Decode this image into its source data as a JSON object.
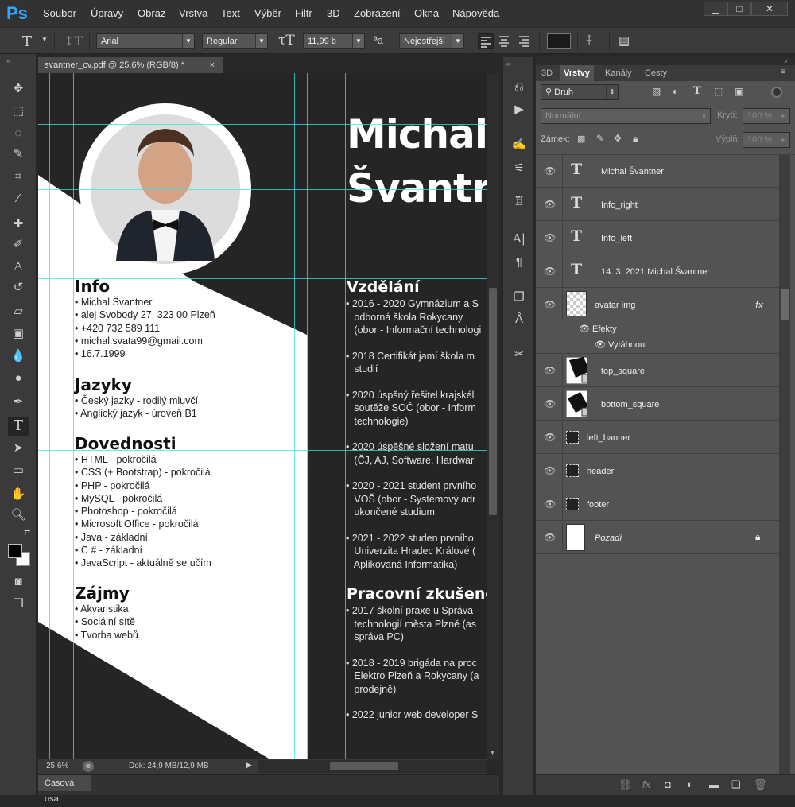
{
  "app": {
    "logo": "Ps"
  },
  "menu": [
    "Soubor",
    "Úpravy",
    "Obraz",
    "Vrstva",
    "Text",
    "Výběr",
    "Filtr",
    "3D",
    "Zobrazení",
    "Okna",
    "Nápověda"
  ],
  "window_controls": {
    "minimize": "▁",
    "maximize": "□",
    "close": "✕"
  },
  "options": {
    "font_family": "Arial",
    "font_style": "Regular",
    "font_size": "11,99 b",
    "antialias": "Nejostřejší",
    "color_hex": "#1a1a1a"
  },
  "document": {
    "tab_title": "svantner_cv.pdf @ 25,6% (RGB/8) *",
    "close": "×",
    "zoom": "25,6%",
    "doc_size": "Dok: 24,9 MB/12,9 MB"
  },
  "timeline_label": "Časová osa",
  "cv": {
    "name_line1": "Michal",
    "name_line2": "Švantr",
    "info": {
      "heading": "Info",
      "lines": [
        "• Michal Švantner",
        "• alej Svobody 27, 323 00 Plzeň",
        "• +420 732 589 111",
        "• michal.svata99@gmail.com",
        "• 16.7.1999"
      ]
    },
    "languages": {
      "heading": "Jazyky",
      "lines": [
        "• Český jazky - rodilý mluvčí",
        "• Anglický jazyk - úroveň B1"
      ]
    },
    "skills": {
      "heading": "Dovednosti",
      "lines": [
        "• HTML - pokročilá",
        "• CSS (+ Bootstrap) - pokročilá",
        "• PHP - pokročilá",
        "• MySQL - pokročilá",
        "• Photoshop - pokročilá",
        "• Microsoft Office - pokročilá",
        "• Java - základní",
        "• C # - základní",
        "• JavaScript - aktuálně se učím"
      ]
    },
    "hobbies": {
      "heading": "Zájmy",
      "lines": [
        "• Akvaristika",
        "• Sociální sítě",
        "• Tvorba webů"
      ]
    },
    "education": {
      "heading": "Vzdělání",
      "lines": [
        "• 2016 - 2020 Gymnázium a S",
        "   odborná škola Rokycany",
        "   (obor - Informační technologi",
        "",
        "• 2018 Certifikát jamí škola m",
        "   studií",
        "",
        "• 2020 úspšný řešitel krajskél",
        "   soutěže SOČ (obor - Inform",
        "   technologie)",
        "",
        "• 2020 úspěšné složení matu",
        "   (ČJ, AJ, Software, Hardwar",
        "",
        "• 2020 - 2021 student prvního",
        "   VOŠ (obor - Systémový adr",
        "   ukončené studium",
        "",
        "• 2021 - 2022 studen prvního",
        "   Univerzita Hradec Králové (",
        "   Aplikovaná Informatika)"
      ]
    },
    "experience": {
      "heading": "Pracovní zkušeno",
      "lines": [
        "• 2017 školní praxe u Správa",
        "   technologií města Plzně (as",
        "   správa PC)",
        "",
        "• 2018 - 2019 brigáda na proc",
        "   Elektro Plzeň a Rokycany (a",
        "   prodejně)",
        "",
        "• 2022 junior web developer S"
      ]
    }
  },
  "panel": {
    "tabs": [
      "3D",
      "Vrstvy",
      "Kanály",
      "Cesty"
    ],
    "filter_kind": "Druh",
    "blend_mode": "Normální",
    "opacity_label": "Krytí:",
    "opacity_value": "100 %",
    "lock_label": "Zámek:",
    "fill_label": "Výplň:",
    "fill_value": "100 %",
    "layers": [
      {
        "name": "Michal Švantner",
        "kind": "text"
      },
      {
        "name": "Info_right",
        "kind": "text"
      },
      {
        "name": "Info_left",
        "kind": "text"
      },
      {
        "name": "14. 3. 2021 Michal Švantner",
        "kind": "text"
      },
      {
        "name": "avatar img",
        "kind": "image",
        "fx": "fx"
      },
      {
        "name": "top_square",
        "kind": "shape"
      },
      {
        "name": "bottom_square",
        "kind": "shape"
      },
      {
        "name": "left_banner",
        "kind": "smart"
      },
      {
        "name": "header",
        "kind": "smart"
      },
      {
        "name": "footer",
        "kind": "smart"
      },
      {
        "name": "Pozadí",
        "kind": "background"
      }
    ],
    "effects_label": "Efekty",
    "effect_stroke": "Vytáhnout"
  }
}
